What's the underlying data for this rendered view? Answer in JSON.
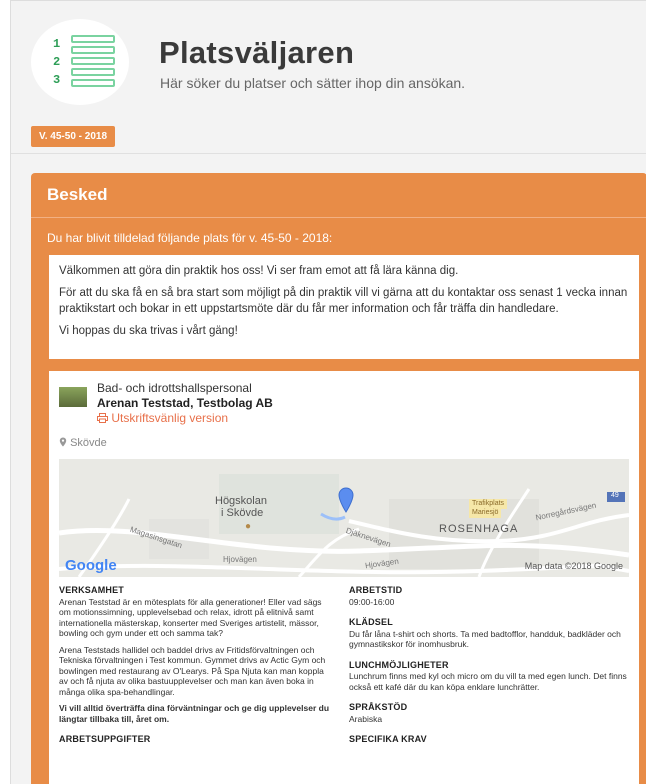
{
  "header": {
    "title": "Platsväljaren",
    "subtitle": "Här söker du platser och sätter ihop din ansökan.",
    "logo_numbers": [
      "1",
      "2",
      "3"
    ]
  },
  "week_badge": "V. 45-50 - 2018",
  "panel": {
    "title": "Besked",
    "intro": "Du har blivit tilldelad följande plats för v. 45-50 - 2018:",
    "welcome_paragraphs": [
      "Välkommen att göra din praktik hos oss! Vi ser fram emot att få lära känna dig.",
      "För att du ska få en så bra start som möjligt på din praktik vill vi gärna att du kontaktar oss senast 1 vecka innan praktikstart och bokar in ett uppstartsmöte där du får mer information och får träffa din handledare.",
      "Vi hoppas du ska trivas i vårt gäng!"
    ]
  },
  "placement": {
    "job_type": "Bad- och idrottshallspersonal",
    "employer": "Arenan Teststad, Testbolag AB",
    "print_link": "Utskriftsvänlig version",
    "location": "Skövde"
  },
  "map": {
    "labels": {
      "hogskolan1": "Högskolan",
      "hogskolan2": "i Skövde",
      "magasinsgatan": "Magasinsgatan",
      "trafikplats1": "Trafikplats",
      "trafikplats2": "Mariesjö",
      "rosenhaga": "ROSENHAGA",
      "norregard": "Norregårdsvägen",
      "hjovagen1": "Hjovägen",
      "hjovagen2": "Hjovägen",
      "djaknevagen": "Djäknevägen",
      "road_number": "49"
    },
    "brand": "Google",
    "attribution": "Map data ©2018 Google"
  },
  "details_left": [
    {
      "heading": "VERKSAMHET",
      "paragraphs": [
        "Arenan Teststad är en mötesplats för alla generationer! Eller vad sägs om motionssimning, upplevelsebad och relax, idrott på elitnivå samt internationella mästerskap, konserter med Sveriges artistelit, mässor, bowling och gym under ett och samma tak?",
        "Arena Teststads hallidel och baddel drivs av Fritidsförvaltningen och Tekniska förvaltningen i Test kommun. Gymmet drivs av Actic Gym och bowlingen med restaurang av O'Learys. På Spa Njuta kan man koppla av och få njuta av olika bastuupplevelser och man kan även boka in många olika spa-behandlingar.",
        "Vi vill alltid överträffa dina förväntningar och ge dig upplevelser du längtar tillbaka till, året om."
      ]
    },
    {
      "heading": "ARBETSUPPGIFTER",
      "paragraphs": []
    }
  ],
  "details_right": [
    {
      "heading": "ARBETSTID",
      "text": "09:00-16:00"
    },
    {
      "heading": "KLÄDSEL",
      "text": "Du får låna t-shirt och shorts. Ta med badtofflor, handduk, badkläder och gymnastikskor för inomhusbruk."
    },
    {
      "heading": "LUNCHMÖJLIGHETER",
      "text": "Lunchrum finns med kyl och micro om du vill ta med egen lunch. Det finns också ett kafé där du kan köpa enklare lunchrätter."
    },
    {
      "heading": "SPRÅKSTÖD",
      "text": "Arabiska"
    },
    {
      "heading": "SPECIFIKA KRAV",
      "text": ""
    }
  ],
  "colors": {
    "accent": "#e88c47",
    "logo_green": "#2e9e57",
    "link": "#e8704a",
    "background": "#f3f3f3"
  },
  "icons": {
    "location": "map-pin-icon",
    "print": "printer-icon",
    "map_marker": "map-marker-icon"
  }
}
